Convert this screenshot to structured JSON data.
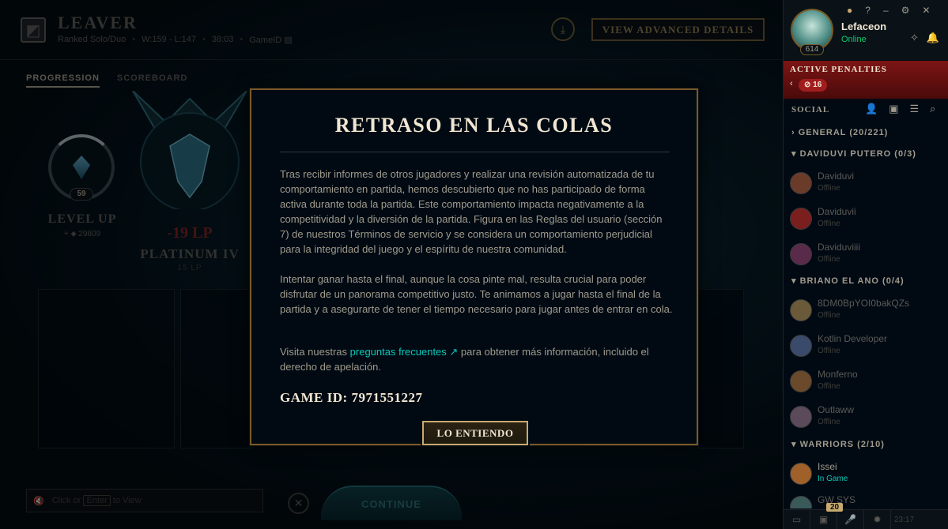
{
  "header": {
    "title": "LEAVER",
    "queue": "Ranked Solo/Duo",
    "record": "W:159 - L:147",
    "duration": "38:03",
    "game_id_label": "GameID",
    "advanced_button": "VIEW ADVANCED DETAILS"
  },
  "tabs": [
    "PROGRESSION",
    "SCOREBOARD"
  ],
  "progression": {
    "level": "59",
    "level_up": "LEVEL UP",
    "xp": "+ ⬥ 29809",
    "lp_change": "-19 LP",
    "rank": "PLATINUM IV",
    "rank_lp": "15 LP"
  },
  "chat": {
    "prefix": "Click or",
    "key": "Enter",
    "suffix": "to View"
  },
  "continue_label": "CONTINUE",
  "modal": {
    "title": "RETRASO EN LAS COLAS",
    "p1": "Tras recibir informes de otros jugadores y realizar una revisión automatizada de tu comportamiento en partida, hemos descubierto que no has participado de forma activa durante toda la partida. Este comportamiento impacta negativamente a la competitividad y la diversión de la partida. Figura en las Reglas del usuario (sección 7) de nuestros Términos de servicio y se considera un comportamiento perjudicial para la integridad del juego y el espíritu de nuestra comunidad.",
    "p2": "Intentar ganar hasta el final, aunque la cosa pinte mal, resulta crucial para poder disfrutar de un panorama competitivo justo. Te animamos a jugar hasta el final de la partida y a asegurarte de tener el tiempo necesario para jugar antes de entrar en cola.",
    "p3_pre": "Visita nuestras",
    "p3_link": "preguntas frecuentes ↗",
    "p3_post": "para obtener más información, incluido el derecho de apelación.",
    "game_id": "GAME ID: 7971551227",
    "ok_button": "LO ENTIENDO"
  },
  "summoner": {
    "name": "Lefaceon",
    "status": "Online",
    "level": "614"
  },
  "penalties": {
    "title": "ACTIVE PENALTIES",
    "count": "16"
  },
  "social": {
    "title": "SOCIAL",
    "groups": [
      {
        "label": "GENERAL (20/221)",
        "collapsed": true
      },
      {
        "label": "DAVIDUVI PUTERO (0/3)",
        "collapsed": false
      },
      {
        "label": "BRIANO EL ANO (0/4)",
        "collapsed": false
      },
      {
        "label": "WARRIORS (2/10)",
        "collapsed": false
      }
    ],
    "friends": [
      {
        "name": "Daviduvi",
        "status": "Offline",
        "color": "#6b3b2a"
      },
      {
        "name": "Daviduvii",
        "status": "Offline",
        "color": "#7a1e1e"
      },
      {
        "name": "Daviduviiii",
        "status": "Offline",
        "color": "#5a2a4a"
      },
      {
        "name": "8DM0BpYOI0bakQZs",
        "status": "Offline",
        "color": "#6a5a3a"
      },
      {
        "name": "Kotlin Developer",
        "status": "Offline",
        "color": "#3a4a6a"
      },
      {
        "name": "Monferno",
        "status": "Offline",
        "color": "#6a4a2a"
      },
      {
        "name": "Outlaww",
        "status": "Offline",
        "color": "#5a4a5a"
      },
      {
        "name": "Issei",
        "status": "In Game",
        "color": "#a0602a"
      },
      {
        "name": "GW SYS",
        "status": "",
        "color": "#3a5a5a"
      }
    ]
  },
  "bottom": {
    "badge": "20",
    "time": "23:17"
  },
  "colors": {
    "gold": "#c8aa6e",
    "penalty": "#7d1515",
    "online": "#0acb6a"
  }
}
